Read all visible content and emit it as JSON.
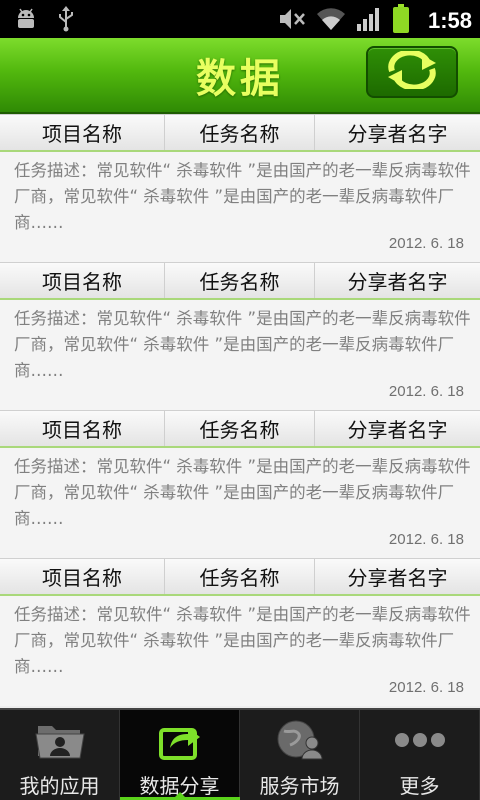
{
  "status_bar": {
    "time": "1:58"
  },
  "header": {
    "title": "数据"
  },
  "columns": [
    "项目名称",
    "任务名称",
    "分享者名字"
  ],
  "items": [
    {
      "description": "任务描述：常见软件“ 杀毒软件 ”是由国产的老一辈反病毒软件厂商，常见软件“ 杀毒软件 ”是由国产的老一辈反病毒软件厂商……",
      "date": "2012. 6. 18"
    },
    {
      "description": "任务描述：常见软件“ 杀毒软件 ”是由国产的老一辈反病毒软件厂商，常见软件“ 杀毒软件 ”是由国产的老一辈反病毒软件厂商……",
      "date": "2012. 6. 18"
    },
    {
      "description": "任务描述：常见软件“ 杀毒软件 ”是由国产的老一辈反病毒软件厂商，常见软件“ 杀毒软件 ”是由国产的老一辈反病毒软件厂商……",
      "date": "2012. 6. 18"
    },
    {
      "description": "任务描述：常见软件“ 杀毒软件 ”是由国产的老一辈反病毒软件厂商，常见软件“ 杀毒软件 ”是由国产的老一辈反病毒软件厂商……",
      "date": "2012. 6. 18"
    }
  ],
  "tabs": [
    {
      "label": "我的应用",
      "icon": "folder-user-icon",
      "active": false
    },
    {
      "label": "数据分享",
      "icon": "share-icon",
      "active": true
    },
    {
      "label": "服务市场",
      "icon": "globe-user-icon",
      "active": false
    },
    {
      "label": "更多",
      "icon": "more-dots-icon",
      "active": false
    }
  ],
  "colors": {
    "accent": "#5bd21b",
    "title_text": "#e8ff60"
  }
}
